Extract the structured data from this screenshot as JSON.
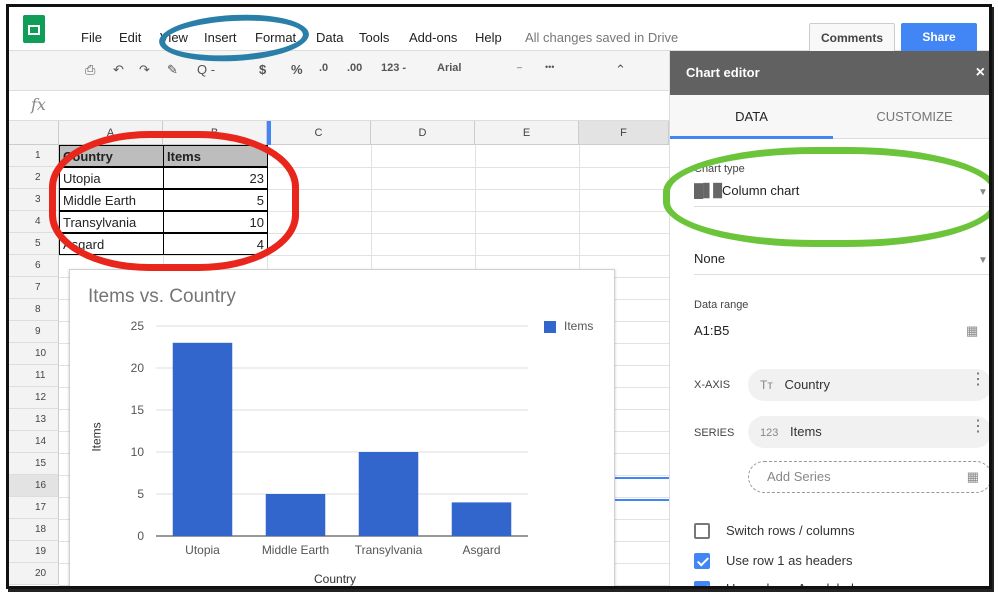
{
  "menu": {
    "items": [
      "File",
      "Edit",
      "View",
      "Insert",
      "Format",
      "Data",
      "Tools",
      "Add-ons",
      "Help"
    ],
    "status": "All changes saved in Drive",
    "comments_label": "Comments",
    "share_label": "Share"
  },
  "toolbar": {
    "font": "Arial",
    "zoom": "Q -",
    "currency": "$",
    "percent": "%",
    "dec_less": ".0",
    "dec_more": ".00",
    "format_123": "123 -",
    "more": "•••"
  },
  "formula_bar": {
    "fx": "fx"
  },
  "grid": {
    "columns": [
      "A",
      "B",
      "C",
      "D",
      "E",
      "F"
    ],
    "rows": [
      "1",
      "2",
      "3",
      "4",
      "5",
      "6",
      "7",
      "8",
      "9",
      "10",
      "11",
      "12",
      "13",
      "14",
      "15",
      "16",
      "17",
      "18",
      "19",
      "20"
    ],
    "table": {
      "header": [
        "Country",
        "Items"
      ],
      "rows": [
        [
          "Utopia",
          "23"
        ],
        [
          "Middle Earth",
          "5"
        ],
        [
          "Transylvania",
          "10"
        ],
        [
          "Asgard",
          "4"
        ]
      ]
    }
  },
  "chart_data": {
    "type": "bar",
    "title": "Items vs. Country",
    "categories": [
      "Utopia",
      "Middle Earth",
      "Transylvania",
      "Asgard"
    ],
    "series": [
      {
        "name": "Items",
        "values": [
          23,
          5,
          10,
          4
        ],
        "color": "#3366cc"
      }
    ],
    "xlabel": "Country",
    "ylabel": "Items",
    "ylim": [
      0,
      25
    ],
    "yticks": [
      "0",
      "5",
      "10",
      "15",
      "20",
      "25"
    ],
    "legend": "right",
    "grid": true
  },
  "editor": {
    "title": "Chart editor",
    "close": "×",
    "tabs": [
      "DATA",
      "CUSTOMIZE"
    ],
    "chart_type_label": "Chart type",
    "chart_type_value": "Column chart",
    "stacking_value": "None",
    "data_range_label": "Data range",
    "data_range_value": "A1:B5",
    "x_axis_label": "X-AXIS",
    "x_axis_value": "Country",
    "series_label": "SERIES",
    "series_value": "Items",
    "add_series": "Add Series",
    "checkboxes": [
      {
        "label": "Switch rows / columns",
        "checked": false
      },
      {
        "label": "Use row 1 as headers",
        "checked": true
      },
      {
        "label": "Use column A as labels",
        "checked": true
      }
    ]
  }
}
